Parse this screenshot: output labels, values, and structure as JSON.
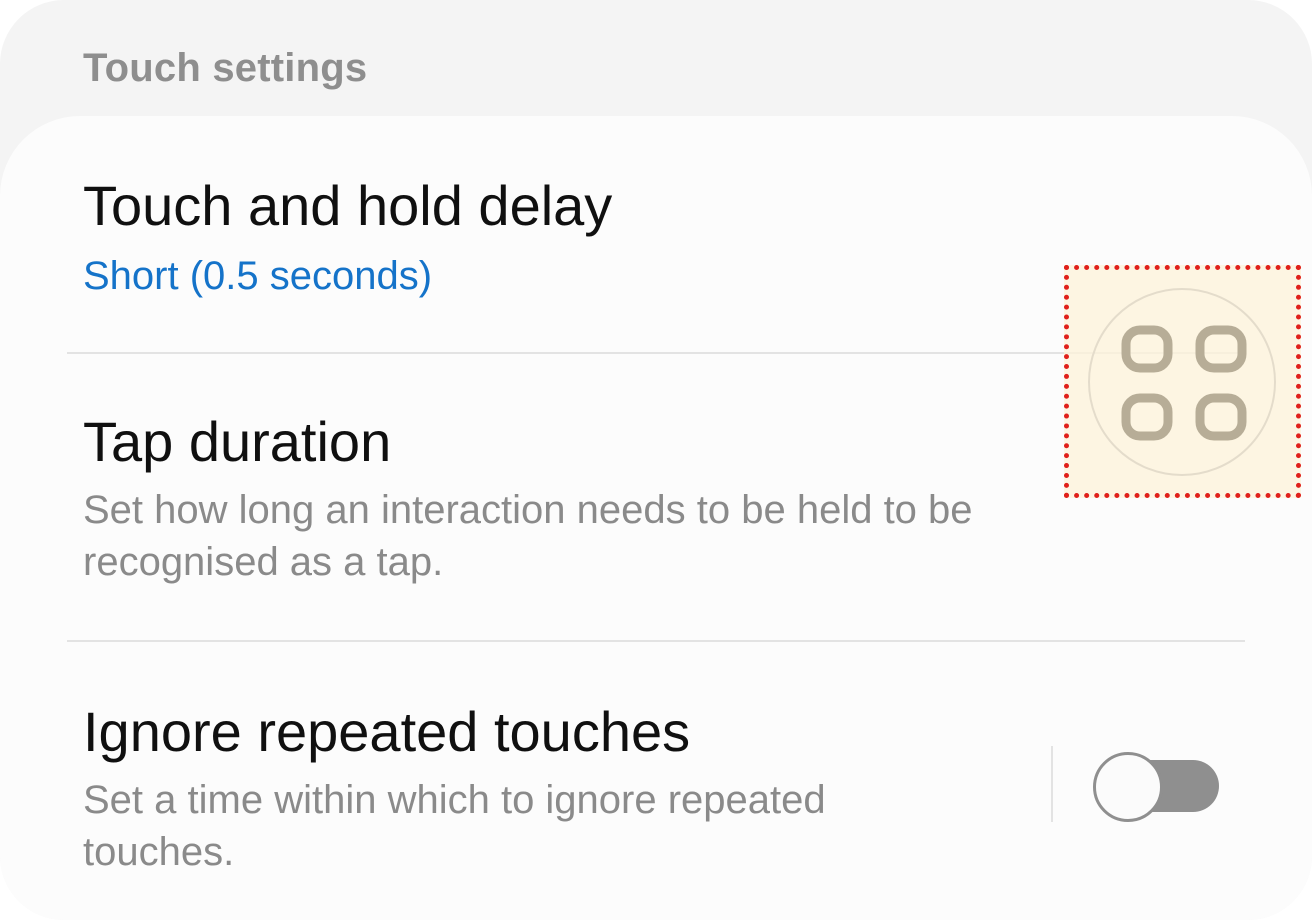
{
  "section": {
    "title": "Touch settings"
  },
  "items": [
    {
      "title": "Touch and hold delay",
      "value": "Short (0.5 seconds)"
    },
    {
      "title": "Tap duration",
      "description": "Set how long an interaction needs to be held to be recognised as a tap."
    },
    {
      "title": "Ignore repeated touches",
      "description": "Set a time within which to ignore repeated touches.",
      "toggle": "off"
    }
  ],
  "overlay": {
    "icon": "four-squares-menu-icon"
  },
  "colors": {
    "accent": "#1573c9",
    "highlight_border": "#e0201b",
    "switch_off": "#8f8f8f"
  }
}
